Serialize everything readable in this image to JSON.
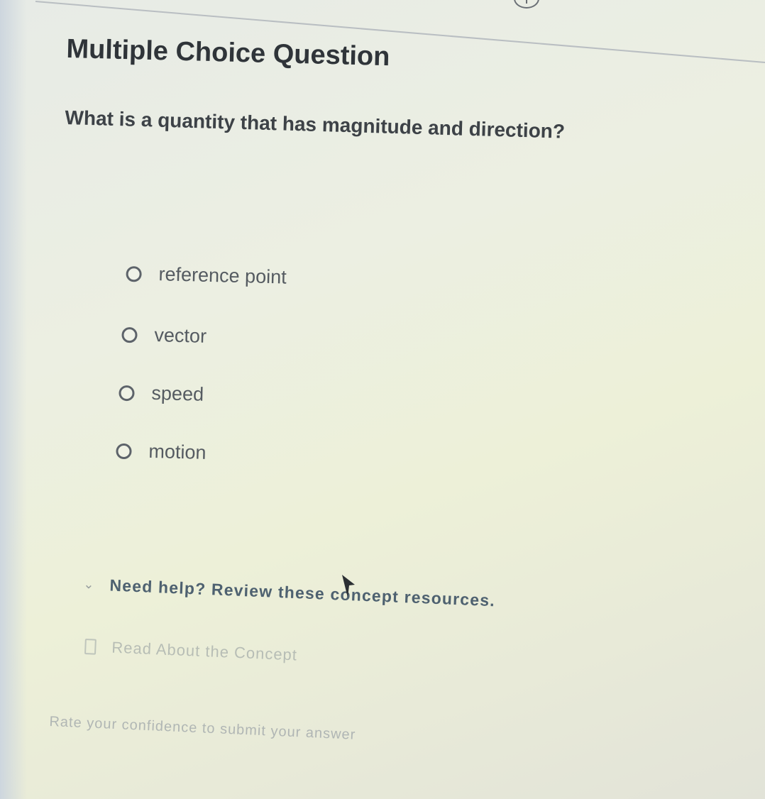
{
  "header": {
    "info_icon": "info-icon",
    "info_label": "i"
  },
  "question": {
    "title": "Multiple Choice Question",
    "prompt": "What is a quantity that has magnitude and direction?"
  },
  "options": [
    {
      "label": "reference point"
    },
    {
      "label": "vector"
    },
    {
      "label": "speed"
    },
    {
      "label": "motion"
    }
  ],
  "help": {
    "icon": "chevron-down-icon",
    "text": "Need help? Review these concept resources."
  },
  "resources": [
    {
      "icon": "book-icon",
      "label": "Read About the Concept"
    }
  ],
  "footer": {
    "confidence_text": "Rate your confidence to submit your answer"
  },
  "colors": {
    "title": "#2f3439",
    "help_link": "#4e6170",
    "radio_border": "#5d636a"
  }
}
